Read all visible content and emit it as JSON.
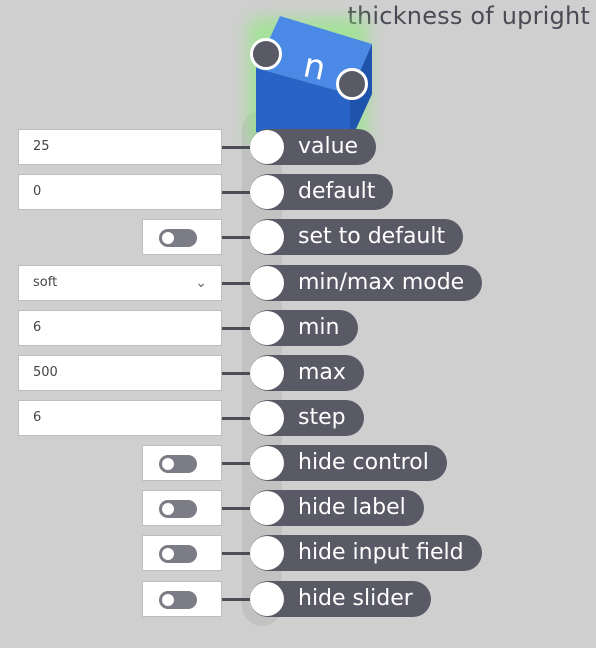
{
  "node": {
    "title": "thickness of upright",
    "glyph": "n",
    "accent": "#2f6fd0",
    "glow": "#7ee86a"
  },
  "rows": [
    {
      "label": "value",
      "control": "text",
      "value": "25"
    },
    {
      "label": "default",
      "control": "text",
      "value": "0"
    },
    {
      "label": "set to default",
      "control": "toggle",
      "checked": false
    },
    {
      "label": "min/max mode",
      "control": "select",
      "value": "soft"
    },
    {
      "label": "min",
      "control": "text",
      "value": "6"
    },
    {
      "label": "max",
      "control": "text",
      "value": "500"
    },
    {
      "label": "step",
      "control": "text",
      "value": "6"
    },
    {
      "label": "hide control",
      "control": "toggle",
      "checked": false
    },
    {
      "label": "hide label",
      "control": "toggle",
      "checked": false
    },
    {
      "label": "hide input field",
      "control": "toggle",
      "checked": false
    },
    {
      "label": "hide slider",
      "control": "toggle",
      "checked": false
    }
  ],
  "icons": {
    "select": "chevron-down-icon",
    "port": "port-icon"
  }
}
